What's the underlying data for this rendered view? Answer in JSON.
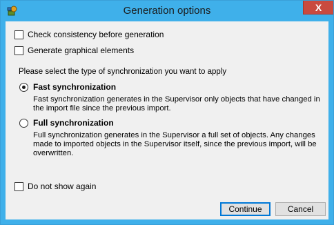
{
  "window": {
    "title": "Generation options",
    "close_glyph": "X"
  },
  "options": {
    "check_consistency": {
      "label": "Check consistency before generation",
      "checked": false
    },
    "graphical_elements": {
      "label": "Generate graphical elements",
      "checked": false
    }
  },
  "sync": {
    "prompt": "Please select the type of synchronization you want to apply",
    "fast": {
      "label": "Fast synchronization",
      "selected": true,
      "description": "Fast synchronization generates in the Supervisor only objects that have changed in the import file since the previous import."
    },
    "full": {
      "label": "Full synchronization",
      "selected": false,
      "description": "Full synchronization generates in the Supervisor a full set of objects. Any changes made to imported objects in the Supervisor itself, since the previous import, will be overwritten."
    }
  },
  "do_not_show": {
    "label": "Do not show again",
    "checked": false
  },
  "buttons": {
    "continue_label": "Continue",
    "cancel_label": "Cancel"
  },
  "colors": {
    "titlebar": "#3fb0ea",
    "close_button": "#c94a3f",
    "client_background": "#f0f0f0",
    "default_button_border": "#0078d7"
  }
}
